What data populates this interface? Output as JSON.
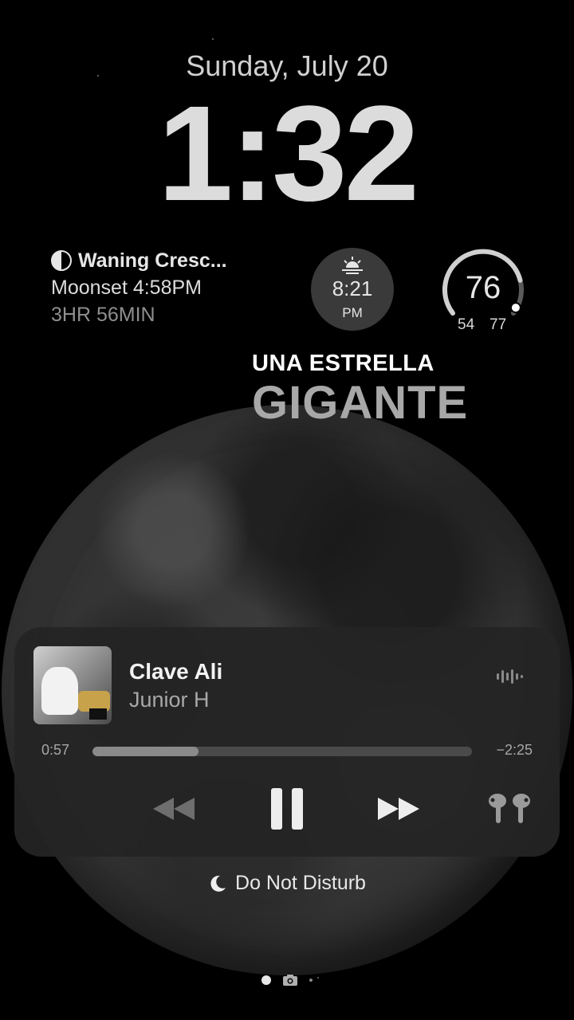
{
  "lock_screen": {
    "date": "Sunday, July 20",
    "time": "1:32"
  },
  "widgets": {
    "moon": {
      "phase": "Waning Cresc...",
      "moonset": "Moonset 4:58PM",
      "duration": "3HR 56MIN",
      "icon": "moon-phase-icon"
    },
    "sunset": {
      "time": "8:21",
      "ampm": "PM",
      "icon": "sunset-icon"
    },
    "weather": {
      "current": "76",
      "low": "54",
      "high": "77",
      "range_position": 0.95
    }
  },
  "wallpaper": {
    "line1": "UNA ESTRELLA",
    "line2": "GIGANTE"
  },
  "now_playing": {
    "title": "Clave Ali",
    "artist": "Junior H",
    "elapsed": "0:57",
    "remaining": "−2:25",
    "progress": 0.28,
    "controls": {
      "previous": "rewind-icon",
      "play_pause": "pause-icon",
      "next": "fast-forward-icon",
      "output": "airpods-icon"
    },
    "visualizer": "waveform-icon"
  },
  "focus": {
    "label": "Do Not Disturb",
    "icon": "crescent-moon-icon"
  },
  "pager": {
    "icon": "camera-icon"
  }
}
